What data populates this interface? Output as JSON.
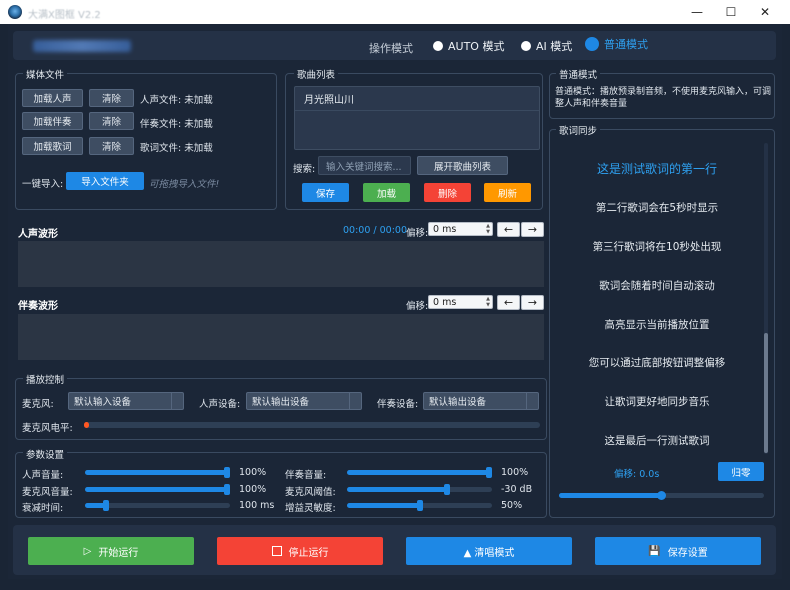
{
  "titlebar": {
    "title": "大满X图框 V2.2"
  },
  "header": {
    "mode_label": "操作模式",
    "modes": [
      {
        "label": "AUTO 模式",
        "selected": false
      },
      {
        "label": "AI 模式",
        "selected": false
      },
      {
        "label": "普通模式",
        "selected": true
      }
    ]
  },
  "media": {
    "title": "媒体文件",
    "rows": [
      {
        "load": "加载人声",
        "clear": "清除",
        "status": "人声文件: 未加载"
      },
      {
        "load": "加载伴奏",
        "clear": "清除",
        "status": "伴奏文件: 未加载"
      },
      {
        "load": "加载歌词",
        "clear": "清除",
        "status": "歌词文件: 未加载"
      }
    ],
    "import_label": "一键导入:",
    "import_button": "导入文件夹",
    "drag_hint": "可拖拽导入文件!"
  },
  "songs": {
    "title": "歌曲列表",
    "items": [
      "月光照山川"
    ],
    "search_label": "搜索:",
    "search_placeholder": "输入关键词搜索...",
    "expand_button": "展开歌曲列表",
    "buttons": {
      "save": "保存",
      "load": "加载",
      "delete": "删除",
      "refresh": "刷新"
    }
  },
  "vocal_wave": {
    "title": "人声波形",
    "time": "00:00 / 00:00",
    "offset_label": "偏移:",
    "offset_value": "0 ms"
  },
  "accomp_wave": {
    "title": "伴奏波形",
    "offset_label": "偏移:",
    "offset_value": "0 ms"
  },
  "playback": {
    "title": "播放控制",
    "mic_label": "麦克风:",
    "mic_value": "默认输入设备",
    "vocal_dev_label": "人声设备:",
    "vocal_dev_value": "默认输出设备",
    "accomp_dev_label": "伴奏设备:",
    "accomp_dev_value": "默认输出设备",
    "mic_level_label": "麦克风电平:",
    "mic_level": 0.01
  },
  "params": {
    "title": "参数设置",
    "left": [
      {
        "label": "人声音量:",
        "value": "100%",
        "level": 1.0
      },
      {
        "label": "麦克风音量:",
        "value": "100%",
        "level": 1.0
      },
      {
        "label": "衰减时间:",
        "value": "100 ms",
        "level": 0.13
      }
    ],
    "right": [
      {
        "label": "伴奏音量:",
        "value": "100%",
        "level": 1.0
      },
      {
        "label": "麦克风阈值:",
        "value": "-30 dB",
        "level": 0.7
      },
      {
        "label": "增益灵敏度:",
        "value": "50%",
        "level": 0.5
      }
    ]
  },
  "normal_mode": {
    "title": "普通模式",
    "desc": "普通模式：播放预录制音频，不使用麦克风输入，可调整人声和伴奏音量"
  },
  "lyrics": {
    "title": "歌词同步",
    "lines": [
      "这是测试歌词的第一行",
      "第二行歌词会在5秒时显示",
      "第三行歌词将在10秒处出现",
      "歌词会随着时间自动滚动",
      "高亮显示当前播放位置",
      "您可以通过底部按钮调整偏移",
      "让歌词更好地同步音乐",
      "这是最后一行测试歌词"
    ],
    "offset_text": "偏移: 0.0s",
    "reset_button": "归零",
    "offset_level": 0.5
  },
  "actions": {
    "start": "开始运行",
    "stop": "停止运行",
    "chorus": "▲ 清唱模式",
    "save": "保存设置"
  },
  "colors": {
    "accent": "#1e88e5",
    "green": "#4caf50",
    "red": "#f44336",
    "orange": "#ff9800"
  }
}
